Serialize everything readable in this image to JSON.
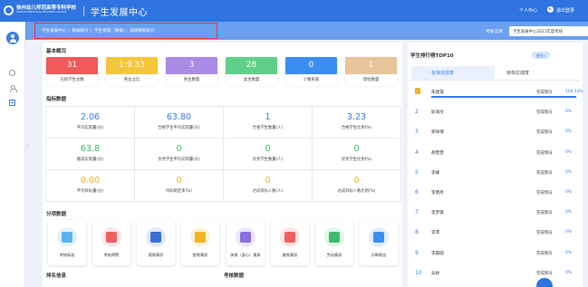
{
  "header": {
    "school_name": "徐州幼儿师范高等专科学校",
    "school_name_en": "XUZHOU PRESCHOOL TEACHERS COLLEGE",
    "app_title": "学生发展中心",
    "personal_center": "个人中心",
    "logout": "退出登录"
  },
  "breadcrumb": {
    "text": "学生发展中心 〉数据统计 〉学生管理（数据）〉成绩数据统计"
  },
  "assessment": {
    "label": "考核实例",
    "selected": "学生发展中心2021年度考核"
  },
  "overview": {
    "title": "基本概况",
    "cards": [
      {
        "value": "31",
        "label": "在校学生总数",
        "color": "#f05a5a"
      },
      {
        "value": "1:9.33",
        "label": "男女占比",
        "color": "#f5c63b"
      },
      {
        "value": "3",
        "label": "男生数量",
        "color": "#a98ae6"
      },
      {
        "value": "28",
        "label": "女生数量",
        "color": "#5fd08a"
      },
      {
        "value": "0",
        "label": "少数民族",
        "color": "#3b8df0"
      },
      {
        "value": "1",
        "label": "現役数量",
        "color": "#e8c49a"
      }
    ]
  },
  "indicators": {
    "title": "指标数据",
    "cells": [
      {
        "value": "2.06",
        "label": "平均实际量(分)",
        "color": "#3b7de9"
      },
      {
        "value": "63.80",
        "label": "合格学生平均实际量(分)",
        "color": "#3b7de9"
      },
      {
        "value": "1",
        "label": "合格学生数量(人)",
        "color": "#3b7de9"
      },
      {
        "value": "3.23",
        "label": "合格学生比例(%)",
        "color": "#3b7de9"
      },
      {
        "value": "63.8",
        "label": "最高实际量(分)",
        "color": "#3dbb6c"
      },
      {
        "value": "0",
        "label": "优秀学生平均实际量(分)",
        "color": "#3dbb6c"
      },
      {
        "value": "0",
        "label": "优秀学生数量(人)",
        "color": "#3dbb6c"
      },
      {
        "value": "0",
        "label": "优秀学生比例(%)",
        "color": "#3dbb6c"
      },
      {
        "value": "0.00",
        "label": "平均目标量(分)",
        "color": "#f0b429"
      },
      {
        "value": "0",
        "label": "目标制定率(%)",
        "color": "#f0b429"
      },
      {
        "value": "0",
        "label": "达成目标人数(人)",
        "color": "#f0b429"
      },
      {
        "value": "0",
        "label": "达成目标人数比例(%)",
        "color": "#f0b429"
      }
    ]
  },
  "categories": {
    "title": "分项数据",
    "items": [
      {
        "label": "考核标准",
        "icon": "chart-icon",
        "color": "#5ab0f0",
        "bg": "#e3f1fd"
      },
      {
        "label": "考核预警",
        "icon": "alarm-icon",
        "color": "#f06060",
        "bg": "#fde6e6"
      },
      {
        "label": "德育素质",
        "icon": "graduate-icon",
        "color": "#3b6fd6",
        "bg": "#e2eafb"
      },
      {
        "label": "智育素质",
        "icon": "book-icon",
        "color": "#f0b429",
        "bg": "#fdf2d9"
      },
      {
        "label": "体育（身心）素质",
        "icon": "card-icon",
        "color": "#8a6ee0",
        "bg": "#ede6fb"
      },
      {
        "label": "美育素质",
        "icon": "art-icon",
        "color": "#f06060",
        "bg": "#fde6e6"
      },
      {
        "label": "劳动素质",
        "icon": "star-icon",
        "color": "#3dbb6c",
        "bg": "#e0f5e8"
      },
      {
        "label": "诊断报告",
        "icon": "report-icon",
        "color": "#3b8df0",
        "bg": "#e2eefd"
      }
    ]
  },
  "bottom": {
    "left_title": "排名信息",
    "mid_title": "考核数据"
  },
  "ranking": {
    "title": "学生排行榜TOP10",
    "more": "更多»",
    "tabs": [
      "标准完成率",
      "目标达成度"
    ],
    "rows": [
      {
        "rank": "1",
        "name": "朱建霞",
        "status": "完成情况",
        "pct": "100.33%",
        "progress": 1.0
      },
      {
        "rank": "2",
        "name": "耿海文",
        "status": "完成情况",
        "pct": "0%",
        "progress": 0
      },
      {
        "rank": "3",
        "name": "郭祥瑞",
        "status": "完成情况",
        "pct": "0%",
        "progress": 0
      },
      {
        "rank": "4",
        "name": "胡雯雯",
        "status": "完成情况",
        "pct": "0%",
        "progress": 0
      },
      {
        "rank": "5",
        "name": "李峰",
        "status": "完成情况",
        "pct": "0%",
        "progress": 0
      },
      {
        "rank": "6",
        "name": "李明月",
        "status": "完成情况",
        "pct": "0%",
        "progress": 0
      },
      {
        "rank": "7",
        "name": "李梦歌",
        "status": "完成情况",
        "pct": "0%",
        "progress": 0
      },
      {
        "rank": "8",
        "name": "李萍",
        "status": "完成情况",
        "pct": "0%",
        "progress": 0
      },
      {
        "rank": "9",
        "name": "李圆圆",
        "status": "完成情况",
        "pct": "0%",
        "progress": 0
      },
      {
        "rank": "10",
        "name": "吴蚊",
        "status": "完成情况",
        "pct": "0%",
        "progress": 0
      }
    ]
  }
}
